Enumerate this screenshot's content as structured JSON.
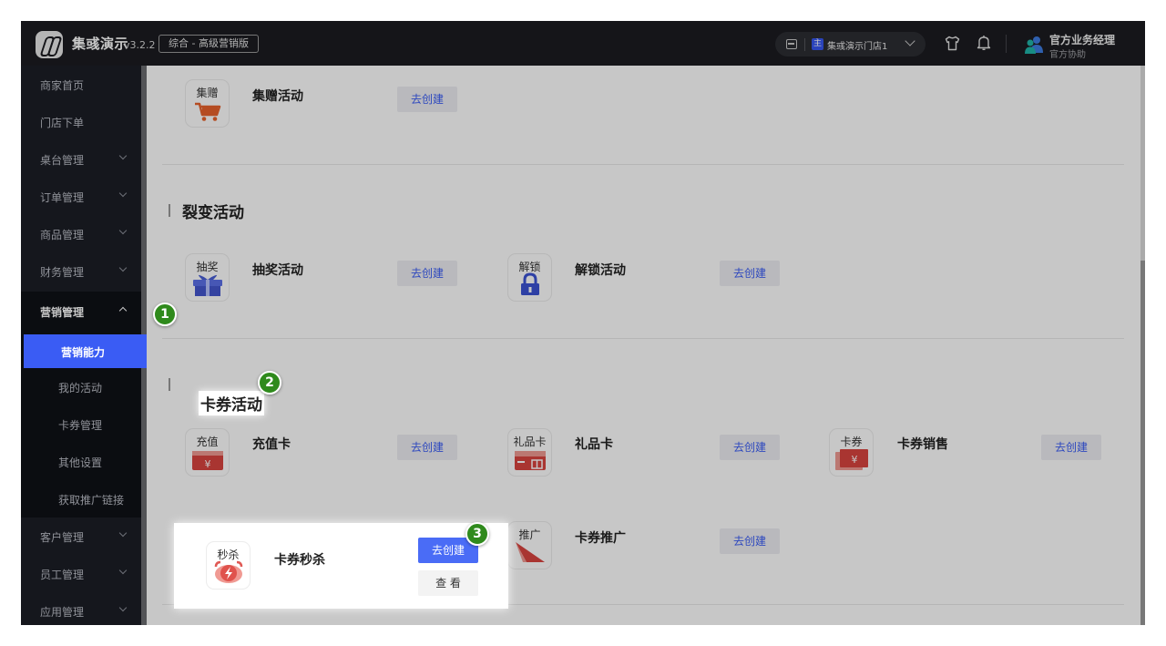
{
  "header": {
    "app_name": "集彧演示",
    "version": "v3.2.2",
    "edition": "综合 - 高级营销版",
    "store": {
      "badge": "主",
      "name": "集彧演示门店1"
    },
    "manager": {
      "title": "官方业务经理",
      "subtitle": "官方协助"
    }
  },
  "sidebar": {
    "items": [
      {
        "label": "商家首页"
      },
      {
        "label": "门店下单"
      },
      {
        "label": "桌台管理"
      },
      {
        "label": "订单管理"
      },
      {
        "label": "商品管理"
      },
      {
        "label": "财务管理"
      },
      {
        "label": "营销管理"
      },
      {
        "label": "客户管理"
      },
      {
        "label": "员工管理"
      },
      {
        "label": "应用管理"
      }
    ],
    "sub_items": [
      {
        "label": "营销能力"
      },
      {
        "label": "我的活动"
      },
      {
        "label": "卡券管理"
      },
      {
        "label": "其他设置"
      },
      {
        "label": "获取推广链接"
      }
    ]
  },
  "sections": {
    "gift": {
      "activities": [
        {
          "tag": "集赠",
          "name": "集赠活动",
          "button": "去创建"
        }
      ]
    },
    "fission": {
      "title": "裂变活动",
      "activities": [
        {
          "tag": "抽奖",
          "name": "抽奖活动",
          "button": "去创建"
        },
        {
          "tag": "解锁",
          "name": "解锁活动",
          "button": "去创建"
        }
      ]
    },
    "coupon": {
      "title": "卡券活动",
      "activities": [
        {
          "tag": "充值",
          "name": "充值卡",
          "button": "去创建"
        },
        {
          "tag": "礼品卡",
          "name": "礼品卡",
          "button": "去创建"
        },
        {
          "tag": "卡券",
          "name": "卡券销售",
          "button": "去创建"
        },
        {
          "tag": "秒杀",
          "name": "卡券秒杀",
          "button": "去创建",
          "secondary_button": "查 看"
        },
        {
          "tag": "推广",
          "name": "卡券推广",
          "button": "去创建"
        }
      ]
    }
  },
  "markers": [
    "1",
    "2",
    "3"
  ],
  "colors": {
    "accent": "#3a5cf4",
    "marker": "#2f8a1c",
    "topbar": "#1b1c21",
    "sidebar": "#1b1e26"
  }
}
